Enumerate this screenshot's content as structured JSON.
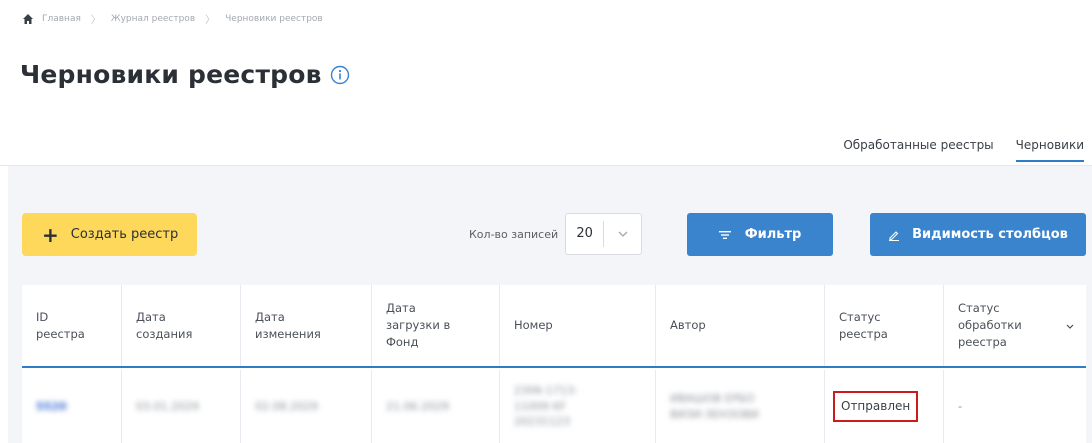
{
  "breadcrumb": [
    "Главная",
    "Журнал реестров",
    "Черновики реестров"
  ],
  "page": {
    "title": "Черновики реестров"
  },
  "tabs": [
    {
      "label": "Обработанные реестры",
      "active": false
    },
    {
      "label": "Черновики",
      "active": true
    }
  ],
  "toolbar": {
    "create_label": "Создать реестр",
    "records_label": "Кол-во записей",
    "records_value": "20",
    "filter_label": "Фильтр",
    "columns_label": "Видимость столбцов"
  },
  "table": {
    "headers": [
      "ID\nреестра",
      "Дата\nсоздания",
      "Дата\nизменения",
      "Дата\nзагрузки в\nФонд",
      "Номер",
      "Автор",
      "Статус\nреестра",
      "Статус\nобработки\nреестра"
    ],
    "rows": [
      {
        "id": "5520",
        "created": "03.01.2029",
        "modified": "02.08.2029",
        "uploaded": "21.06.2029",
        "number": "2306-1713-\n11009 KF\n20231123",
        "author": "ИВАШОВ ЕРБО\nВИЗИ-ЗЕНЗОВИ",
        "status": "Отправлен",
        "processing_status": "-"
      }
    ]
  },
  "colors": {
    "accent": "#3a84cd",
    "create": "#fdd85a",
    "highlight": "#cc1b1b"
  },
  "icons": [
    "home-icon",
    "info-icon",
    "plus-icon",
    "filter-icon",
    "pencil-icon",
    "chevron-down-icon"
  ]
}
